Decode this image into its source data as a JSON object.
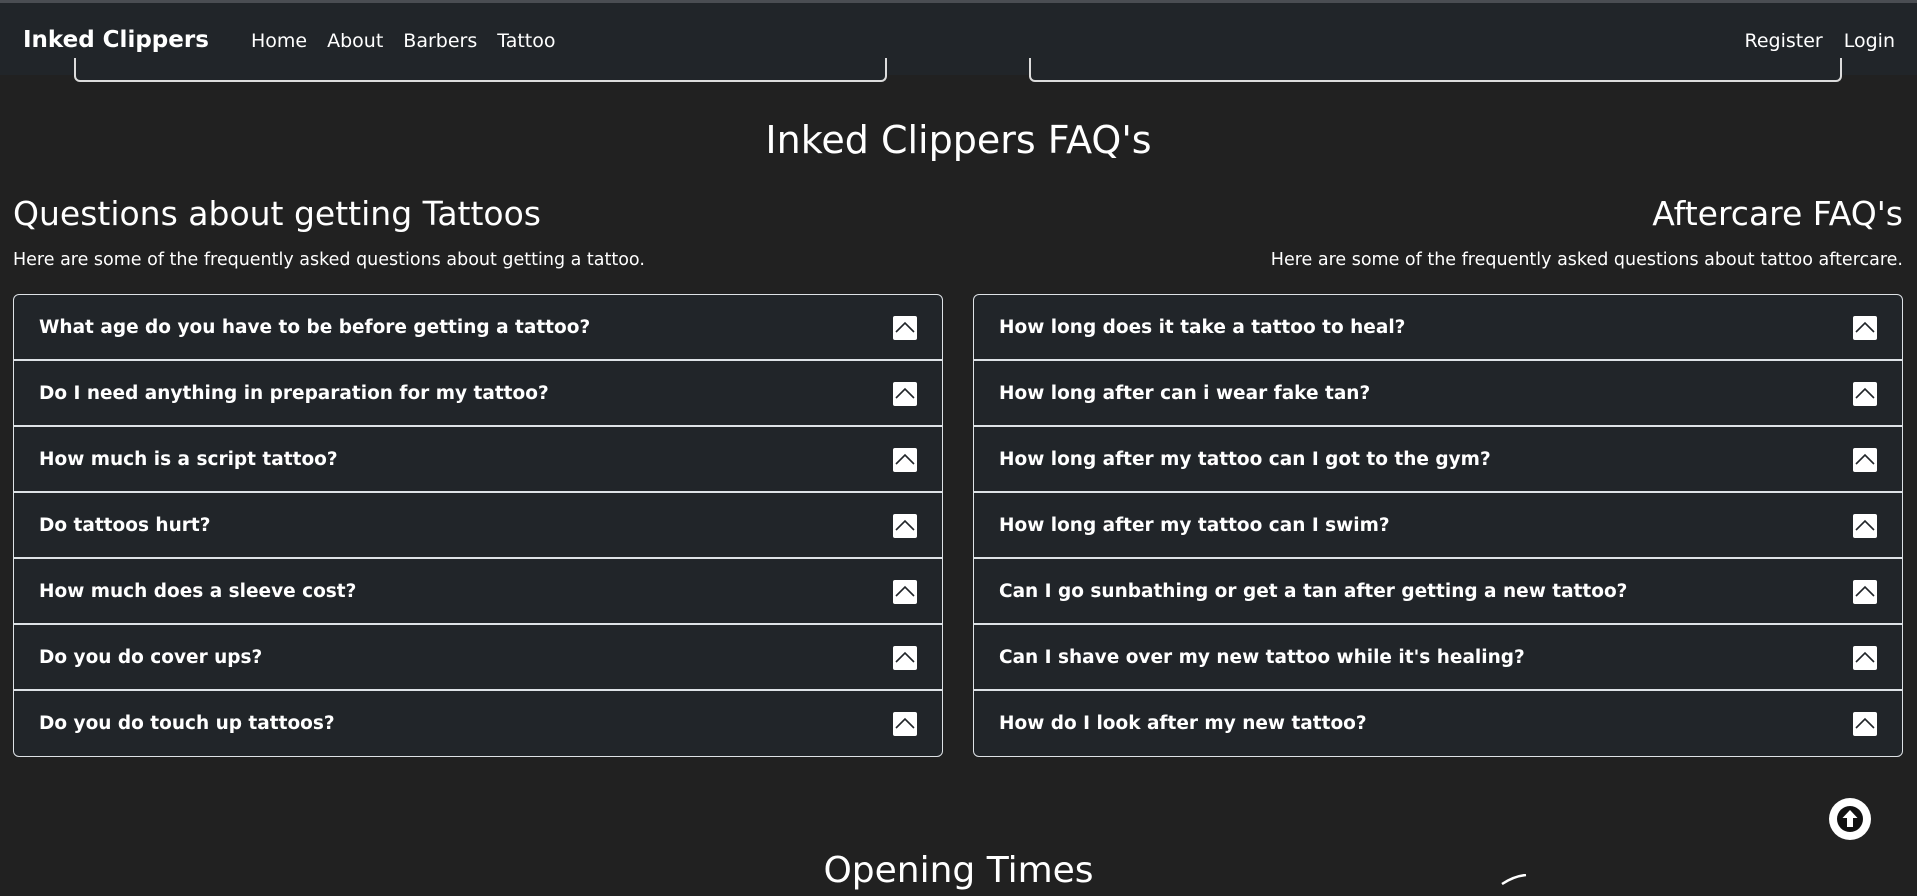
{
  "navbar": {
    "brand": "Inked Clippers",
    "links": [
      {
        "label": "Home"
      },
      {
        "label": "About"
      },
      {
        "label": "Barbers"
      },
      {
        "label": "Tattoo"
      }
    ],
    "right_links": [
      {
        "label": "Register"
      },
      {
        "label": "Login"
      }
    ]
  },
  "faq": {
    "title": "Inked Clippers FAQ's",
    "left": {
      "heading": "Questions about getting Tattoos",
      "subtitle": "Here are some of the frequently asked questions about getting a tattoo.",
      "questions": [
        "What age do you have to be before getting a tattoo?",
        "Do I need anything in preparation for my tattoo?",
        "How much is a script tattoo?",
        "Do tattoos hurt?",
        "How much does a sleeve cost?",
        "Do you do cover ups?",
        "Do you do touch up tattoos?"
      ]
    },
    "right": {
      "heading": "Aftercare FAQ's",
      "subtitle": "Here are some of the frequently asked questions about tattoo aftercare.",
      "questions": [
        "How long does it take a tattoo to heal?",
        "How long after can i wear fake tan?",
        "How long after my tattoo can I got to the gym?",
        "How long after my tattoo can I swim?",
        "Can I go sunbathing or get a tan after getting a new tattoo?",
        "Can I shave over my new tattoo while it's healing?",
        "How do I look after my new tattoo?"
      ]
    },
    "accordion_icon": "chevron-up-icon"
  },
  "opening_times": {
    "title": "Opening Times"
  },
  "scroll_top": {
    "icon": "arrow-up-circle-icon"
  },
  "colors": {
    "page_bg": "#212121",
    "navbar_bg": "#212529",
    "border": "#dee2e6",
    "text": "#ffffff"
  }
}
